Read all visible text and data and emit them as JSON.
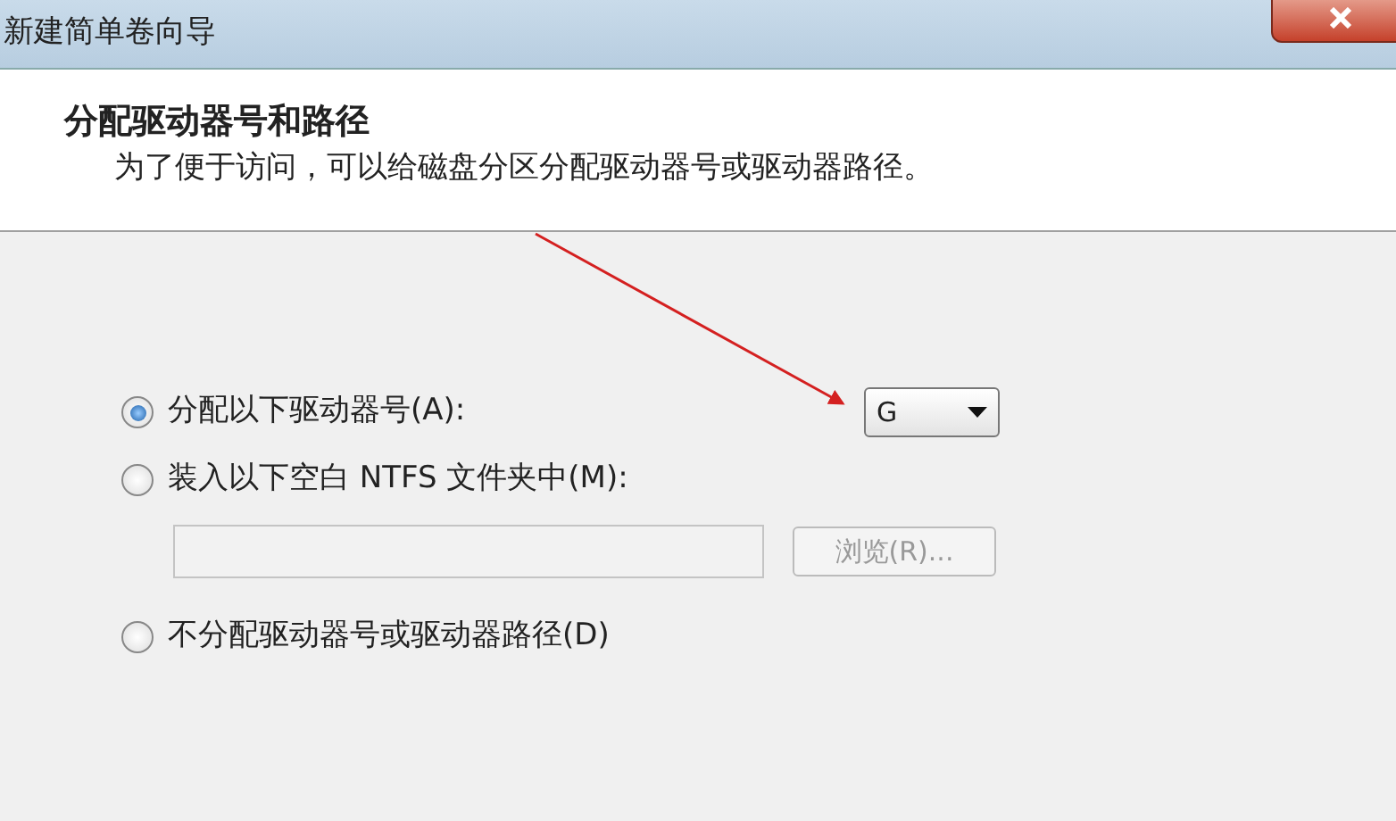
{
  "window": {
    "title": "新建简单卷向导"
  },
  "header": {
    "title": "分配驱动器号和路径",
    "subtitle": "为了便于访问，可以给磁盘分区分配驱动器号或驱动器路径。"
  },
  "options": [
    {
      "label": "分配以下驱动器号(A):",
      "selected": true
    },
    {
      "label": "装入以下空白 NTFS 文件夹中(M):",
      "selected": false
    },
    {
      "label": "不分配驱动器号或驱动器路径(D)",
      "selected": false
    }
  ],
  "drive_letter": {
    "value": "G"
  },
  "folder_field": {
    "disabled": true
  },
  "browse_button": {
    "label": "浏览(R)...",
    "disabled": true
  }
}
